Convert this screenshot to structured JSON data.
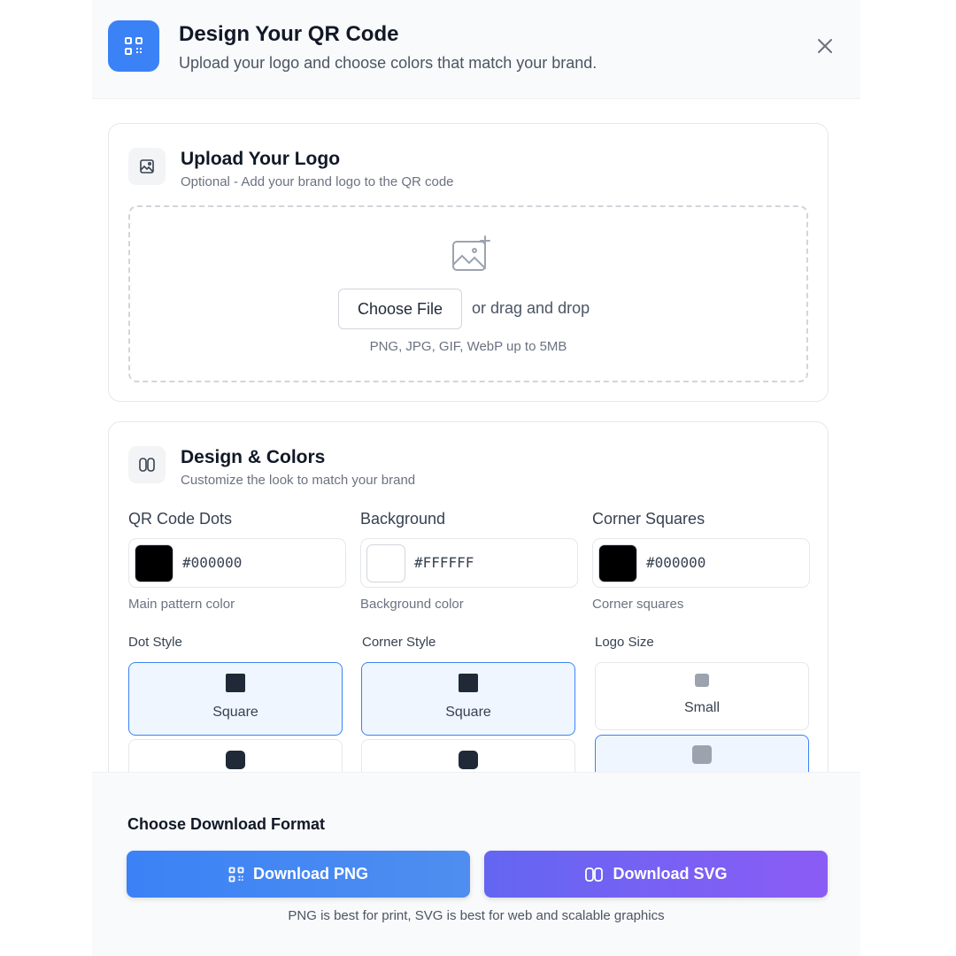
{
  "header": {
    "title": "Design Your QR Code",
    "subtitle": "Upload your logo and choose colors that match your brand.",
    "accent": "#3b82f6"
  },
  "upload": {
    "title": "Upload Your Logo",
    "subtitle": "Optional - Add your brand logo to the QR code",
    "choose_label": "Choose File",
    "drag_text": "or drag and drop",
    "hint": "PNG, JPG, GIF, WebP up to 5MB"
  },
  "design": {
    "title": "Design & Colors",
    "subtitle": "Customize the look to match your brand",
    "colors": [
      {
        "label": "QR Code Dots",
        "value": "#000000",
        "help": "Main pattern color"
      },
      {
        "label": "Background",
        "value": "#FFFFFF",
        "help": "Background color"
      },
      {
        "label": "Corner Squares",
        "value": "#000000",
        "help": "Corner squares"
      }
    ],
    "dot_style": {
      "label": "Dot Style",
      "options": [
        "Square",
        ""
      ],
      "selected": "Square"
    },
    "corner_style": {
      "label": "Corner Style",
      "options": [
        "Square",
        ""
      ],
      "selected": "Square"
    },
    "logo_size": {
      "label": "Logo Size",
      "options": [
        "Small",
        ""
      ],
      "selected_index": 1
    }
  },
  "footer": {
    "title": "Choose Download Format",
    "png_label": "Download PNG",
    "svg_label": "Download SVG",
    "hint": "PNG is best for print, SVG is best for web and scalable graphics",
    "png_color": "#3b82f6",
    "svg_color": "#8b5cf6"
  }
}
